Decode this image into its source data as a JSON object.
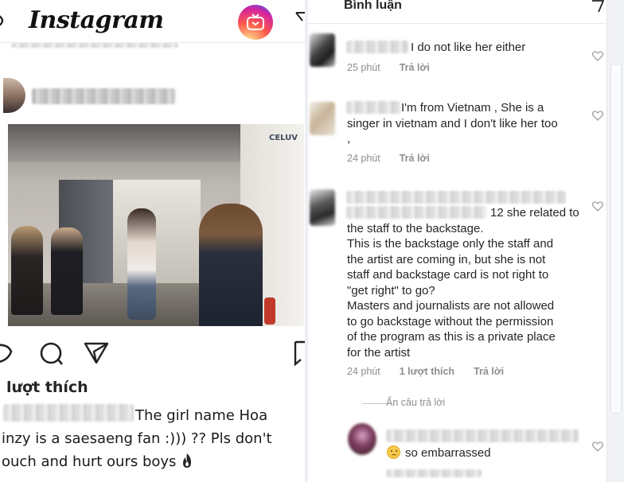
{
  "left_panel": {
    "header": {
      "logo_text": "Instagram",
      "igtv_icon": "igtv-icon",
      "direct_icon": "paper-plane-icon"
    },
    "post": {
      "photo_watermark": "CELUV",
      "actions": [
        "heart-icon",
        "comment-icon",
        "share-icon",
        "bookmark-icon"
      ],
      "likes_label": "lượt thích",
      "caption_lines": [
        "The girl name Hoa",
        "inzy is a saesaeng fan :))) ?? Pls don't",
        "ouch and hurt ours boys"
      ],
      "caption_emoji": "fire-icon"
    }
  },
  "right_panel": {
    "header": {
      "title": "Bình luận",
      "direct_icon": "paper-plane-icon"
    },
    "comments": [
      {
        "text": "I do not like her either",
        "meta": [
          "25 phút",
          "Trả lời"
        ]
      },
      {
        "text_lines": [
          "I'm from Vietnam , She is a",
          "singer in vietnam and I don't like her too",
          ","
        ],
        "meta": [
          "24 phút",
          "Trả lời"
        ]
      },
      {
        "header_fragment": "12 she related to",
        "text_lines": [
          "the staff to the backstage.",
          "This is the backstage only the staff and",
          "the artist are coming in, but she is not",
          "staff and backstage card is not right to",
          "\"get right\" to go?",
          "Masters and journalists are not allowed",
          "to go backstage without the permission",
          "of the program as this is a private place",
          "for the artist"
        ],
        "meta": [
          "24 phút",
          "1 lượt thích",
          "Trả lời"
        ]
      }
    ],
    "hide_replies": "Ẩn câu trả lời",
    "reply": {
      "text": "so embarrassed",
      "emoji": "confused-face-icon"
    }
  }
}
